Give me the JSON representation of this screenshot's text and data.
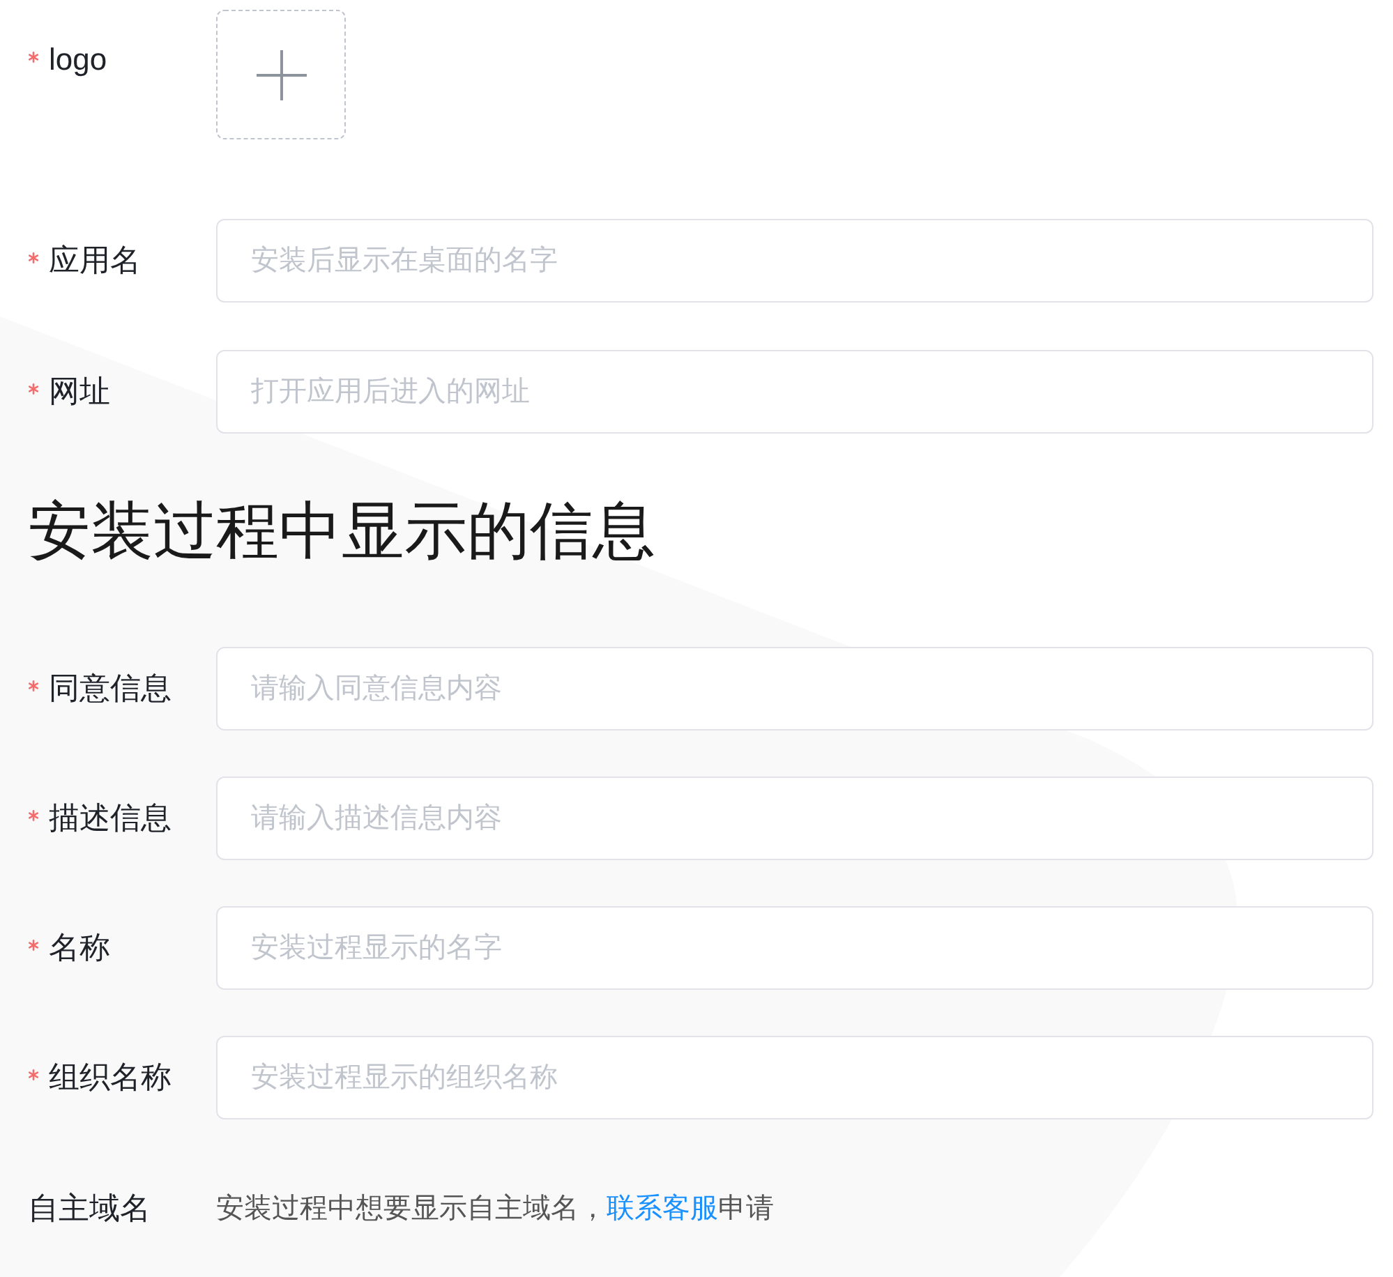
{
  "logo_field": {
    "label": "logo",
    "required": true
  },
  "fields": [
    {
      "label": "应用名",
      "required": true,
      "placeholder": "安装后显示在桌面的名字"
    },
    {
      "label": "网址",
      "required": true,
      "placeholder": "打开应用后进入的网址"
    }
  ],
  "section_title": "安装过程中显示的信息",
  "install_fields": [
    {
      "label": "同意信息",
      "required": true,
      "placeholder": "请输入同意信息内容"
    },
    {
      "label": "描述信息",
      "required": true,
      "placeholder": "请输入描述信息内容"
    },
    {
      "label": "名称",
      "required": true,
      "placeholder": "安装过程显示的名字"
    },
    {
      "label": "组织名称",
      "required": true,
      "placeholder": "安装过程显示的组织名称"
    }
  ],
  "custom_domain": {
    "label": "自主域名",
    "required": false,
    "text": "安装过程中想要显示自主域名，",
    "link": "联系客服",
    "suffix": "申请"
  }
}
